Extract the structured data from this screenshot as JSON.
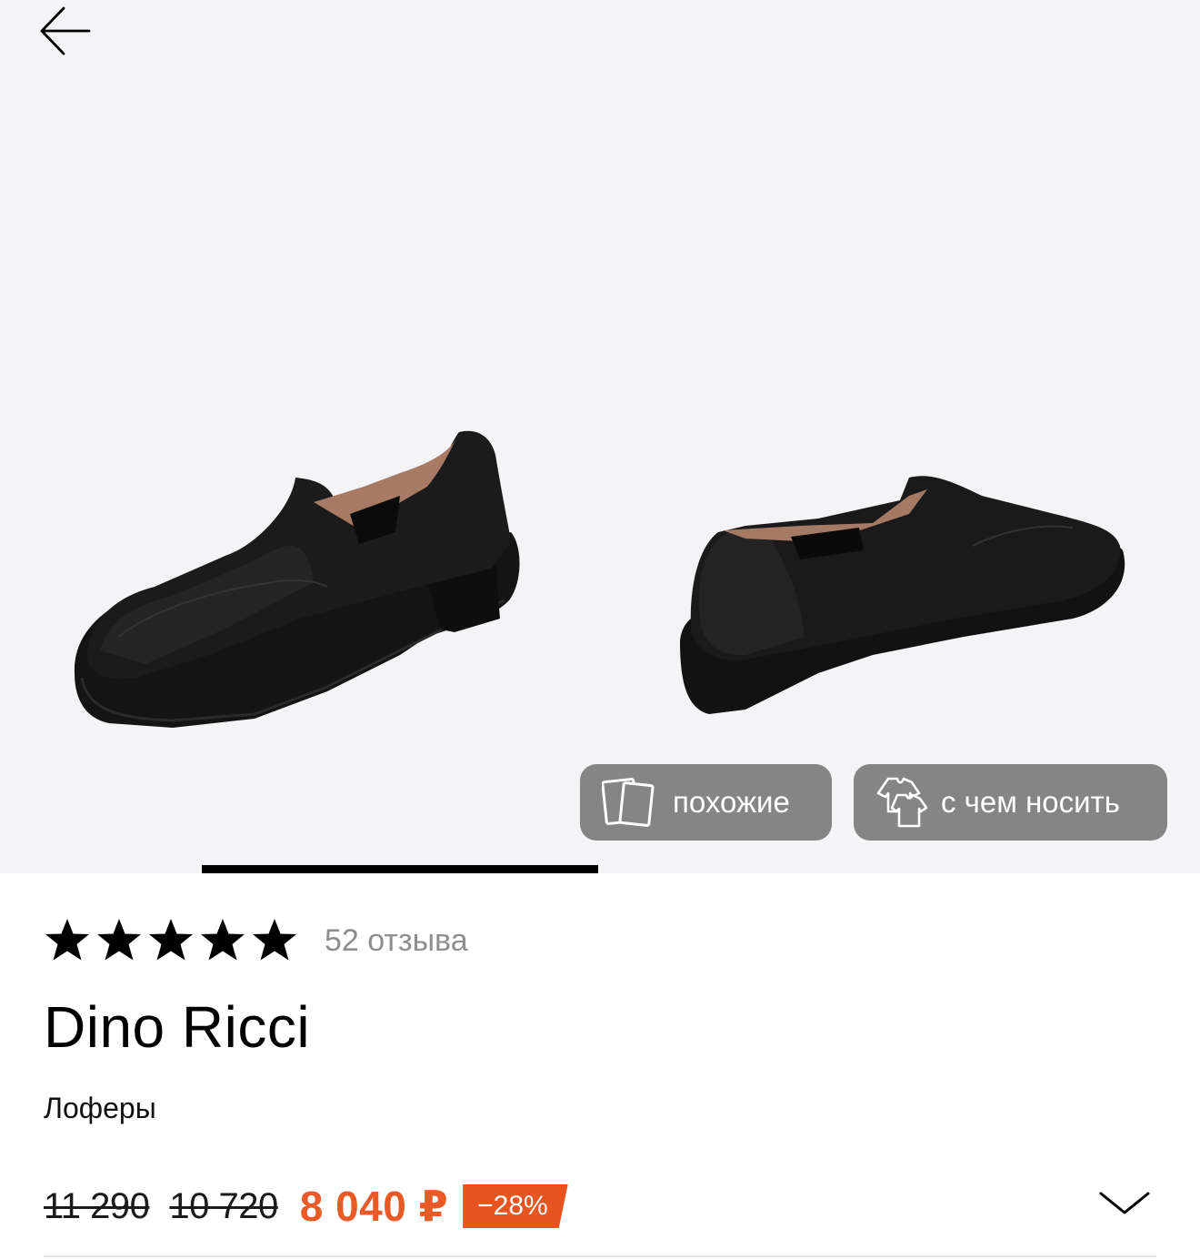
{
  "header": {
    "back_icon": "arrow-left-icon"
  },
  "gallery": {
    "image_alt": "Лоферы Dino Ricci",
    "similar_label": "похожие",
    "similar_icon": "cards-icon",
    "outfit_label": "с чем носить",
    "outfit_icon": "tshirt-icon",
    "slide_progress": 0.33
  },
  "product": {
    "rating_stars": 5,
    "reviews": "52 отзыва",
    "brand": "Dino Ricci",
    "category": "Лоферы",
    "old_price_1": "11 290",
    "old_price_2": "10 720",
    "price": "8 040 ₽",
    "discount": "−28%",
    "expand_icon": "chevron-down-icon"
  },
  "colors": {
    "accent": "#e8541f",
    "price": "#ea5a27",
    "pill_bg": "#858585",
    "gallery_bg": "#f4f4f6"
  }
}
